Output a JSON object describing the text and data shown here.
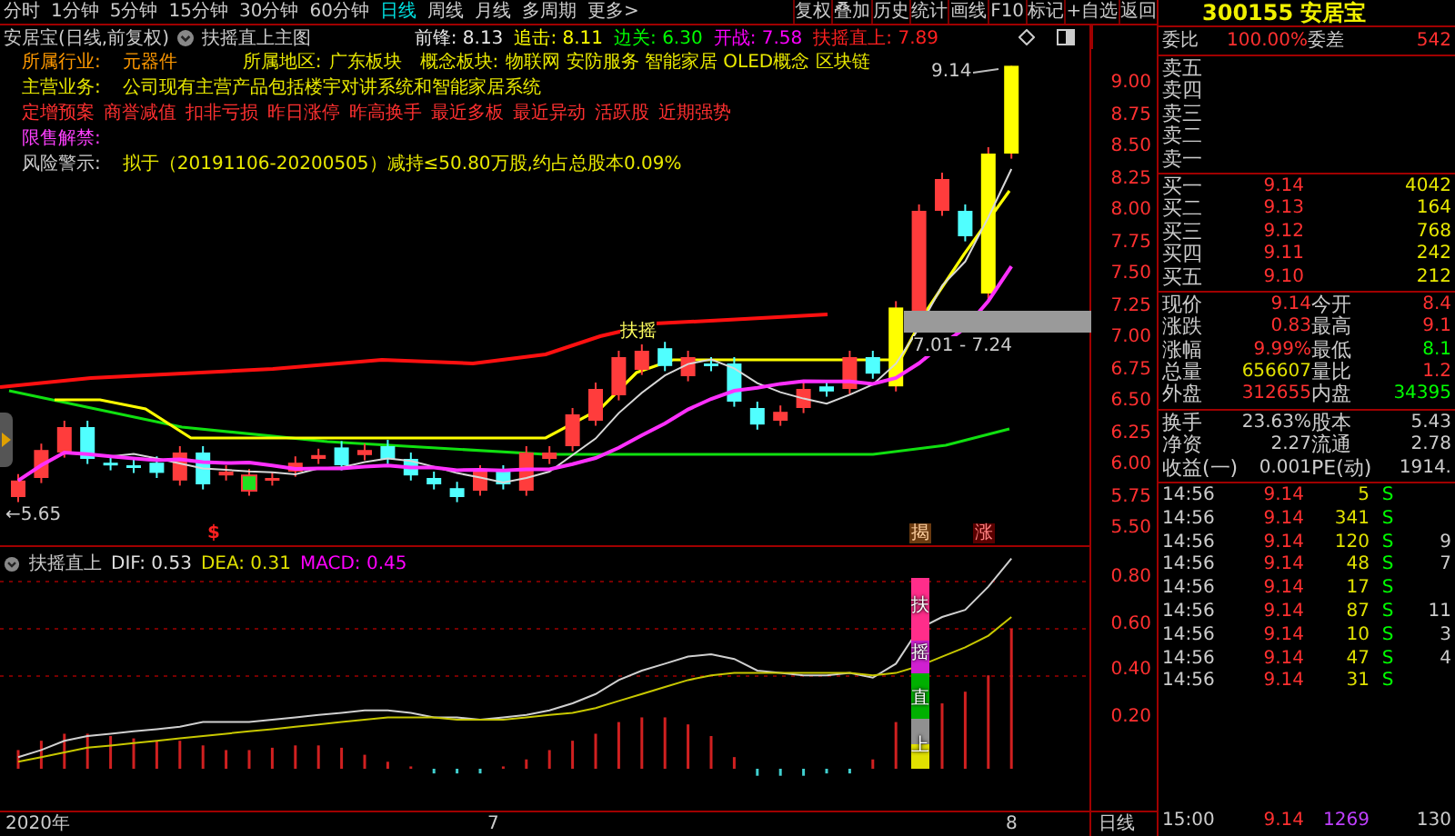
{
  "toolbar": {
    "periods": [
      {
        "label": "分时",
        "selected": false
      },
      {
        "label": "1分钟",
        "selected": false
      },
      {
        "label": "5分钟",
        "selected": false
      },
      {
        "label": "15分钟",
        "selected": false
      },
      {
        "label": "30分钟",
        "selected": false
      },
      {
        "label": "60分钟",
        "selected": false
      },
      {
        "label": "日线",
        "selected": true
      },
      {
        "label": "周线",
        "selected": false
      },
      {
        "label": "月线",
        "selected": false
      },
      {
        "label": "多周期",
        "selected": false
      },
      {
        "label": "更多>",
        "selected": false
      }
    ],
    "buttons": [
      "复权",
      "叠加",
      "历史",
      "统计",
      "画线",
      "F10",
      "标记",
      "+自选",
      "返回"
    ]
  },
  "chart_header": {
    "title": "安居宝(日线,前复权)",
    "indicator": "扶摇直上主图",
    "values": [
      {
        "text": "前锋: 8.13",
        "color": "#e8e8e8"
      },
      {
        "text": "追击: 8.11",
        "color": "#ffff00"
      },
      {
        "text": "边关: 6.30",
        "color": "#00ff00"
      },
      {
        "text": "开战: 7.58",
        "color": "#ff00ff"
      },
      {
        "text": "扶摇直上: 7.89",
        "color": "#ff2020"
      }
    ]
  },
  "info": {
    "industry": {
      "label": "所属行业:",
      "value": "元器件"
    },
    "region": {
      "label": "所属地区:",
      "value": "广东板块"
    },
    "concepts": {
      "label": "概念板块:",
      "value": "物联网 安防服务 智能家居 OLED概念 区块链"
    },
    "business": {
      "label": "主营业务:",
      "value": "公司现有主营产品包括楼宇对讲系统和智能家居系统"
    },
    "tags": [
      "定增预案",
      "商誉减值",
      "扣非亏损",
      "昨日涨停",
      "昨高换手",
      "最近多板",
      "最近异动",
      "活跃股",
      "近期强势"
    ],
    "lockup": {
      "label": "限售解禁:"
    },
    "risk": {
      "label": "风险警示:",
      "value": "拟于（20191106-20200505）减持≤50.80万股,约占总股本0.09%"
    }
  },
  "chart_labels": {
    "high": "9.14",
    "range": "7.01 - 7.24",
    "signal": "扶摇",
    "low": "←5.65",
    "marker": "$",
    "tags": [
      "揭",
      "涨"
    ]
  },
  "price_axis": [
    "9.00",
    "8.75",
    "8.50",
    "8.25",
    "8.00",
    "7.75",
    "7.50",
    "7.25",
    "7.00",
    "6.75",
    "6.50",
    "6.25",
    "6.00",
    "5.75",
    "5.50"
  ],
  "indicator": {
    "name": "扶摇直上",
    "values": [
      {
        "text": "DIF: 0.53",
        "color": "#e0e0e0"
      },
      {
        "text": "DEA: 0.31",
        "color": "#e0e000"
      },
      {
        "text": "MACD: 0.45",
        "color": "#ff00ff"
      }
    ],
    "axis": [
      "0.80",
      "0.60",
      "0.40",
      "0.20"
    ],
    "signal_text": "扶摇直上"
  },
  "date_axis": [
    "2020年",
    "7",
    "8"
  ],
  "period_label": "日线",
  "quote": {
    "code": "300155",
    "name": "安居宝",
    "ratio_label": "委比",
    "ratio": "100.00%",
    "diff_label": "委差",
    "diff": "542",
    "asks": [
      "卖五",
      "卖四",
      "卖三",
      "卖二",
      "卖一"
    ],
    "bids": [
      {
        "label": "买一",
        "price": "9.14",
        "volume": "4042"
      },
      {
        "label": "买二",
        "price": "9.13",
        "volume": "164"
      },
      {
        "label": "买三",
        "price": "9.12",
        "volume": "768"
      },
      {
        "label": "买四",
        "price": "9.11",
        "volume": "242"
      },
      {
        "label": "买五",
        "price": "9.10",
        "volume": "212"
      }
    ],
    "stats": [
      [
        {
          "label": "现价",
          "value": "9.14",
          "color": "#ff3030"
        },
        {
          "label": "今开",
          "value": "8.4",
          "color": "#ff3030"
        }
      ],
      [
        {
          "label": "涨跌",
          "value": "0.83",
          "color": "#ff3030"
        },
        {
          "label": "最高",
          "value": "9.1",
          "color": "#ff3030"
        }
      ],
      [
        {
          "label": "涨幅",
          "value": "9.99%",
          "color": "#ff3030"
        },
        {
          "label": "最低",
          "value": "8.1",
          "color": "#00ff00"
        }
      ],
      [
        {
          "label": "总量",
          "value": "656607",
          "color": "#e0e000"
        },
        {
          "label": "量比",
          "value": "1.2",
          "color": "#ff3030"
        }
      ],
      [
        {
          "label": "外盘",
          "value": "312655",
          "color": "#ff3030"
        },
        {
          "label": "内盘",
          "value": "34395",
          "color": "#00ff00"
        }
      ]
    ],
    "fundamentals": [
      [
        {
          "label": "换手",
          "value": "23.63%"
        },
        {
          "label": "股本",
          "value": "5.43"
        }
      ],
      [
        {
          "label": "净资",
          "value": "2.27"
        },
        {
          "label": "流通",
          "value": "2.78"
        }
      ],
      [
        {
          "label": "收益(一)",
          "value": "0.001"
        },
        {
          "label": "PE(动)",
          "value": "1914."
        }
      ]
    ],
    "ticks": [
      {
        "time": "14:56",
        "price": "9.14",
        "volume": "5",
        "side": "S",
        "color": "#e0e000"
      },
      {
        "time": "14:56",
        "price": "9.14",
        "volume": "341",
        "side": "S",
        "color": "#e0e000"
      },
      {
        "time": "14:56",
        "price": "9.14",
        "volume": "120",
        "side": "S",
        "column_5": "9",
        "color": "#e0e000"
      },
      {
        "time": "14:56",
        "price": "9.14",
        "volume": "48",
        "side": "S",
        "column_5": "7",
        "color": "#e0e000"
      },
      {
        "time": "14:56",
        "price": "9.14",
        "volume": "17",
        "side": "S",
        "color": "#e0e000"
      },
      {
        "time": "14:56",
        "price": "9.14",
        "volume": "87",
        "side": "S",
        "column_5": "11",
        "color": "#e0e000"
      },
      {
        "time": "14:56",
        "price": "9.14",
        "volume": "10",
        "side": "S",
        "column_5": "3",
        "color": "#e0e000"
      },
      {
        "time": "14:56",
        "price": "9.14",
        "volume": "47",
        "side": "S",
        "column_5": "4",
        "color": "#e0e000"
      },
      {
        "time": "14:56",
        "price": "9.14",
        "volume": "31",
        "side": "S",
        "color": "#e0e000"
      }
    ],
    "closing_tick": {
      "time": "15:00",
      "price": "9.14",
      "volume": "1269",
      "column_5": "130",
      "color": "#c040ff"
    }
  }
}
